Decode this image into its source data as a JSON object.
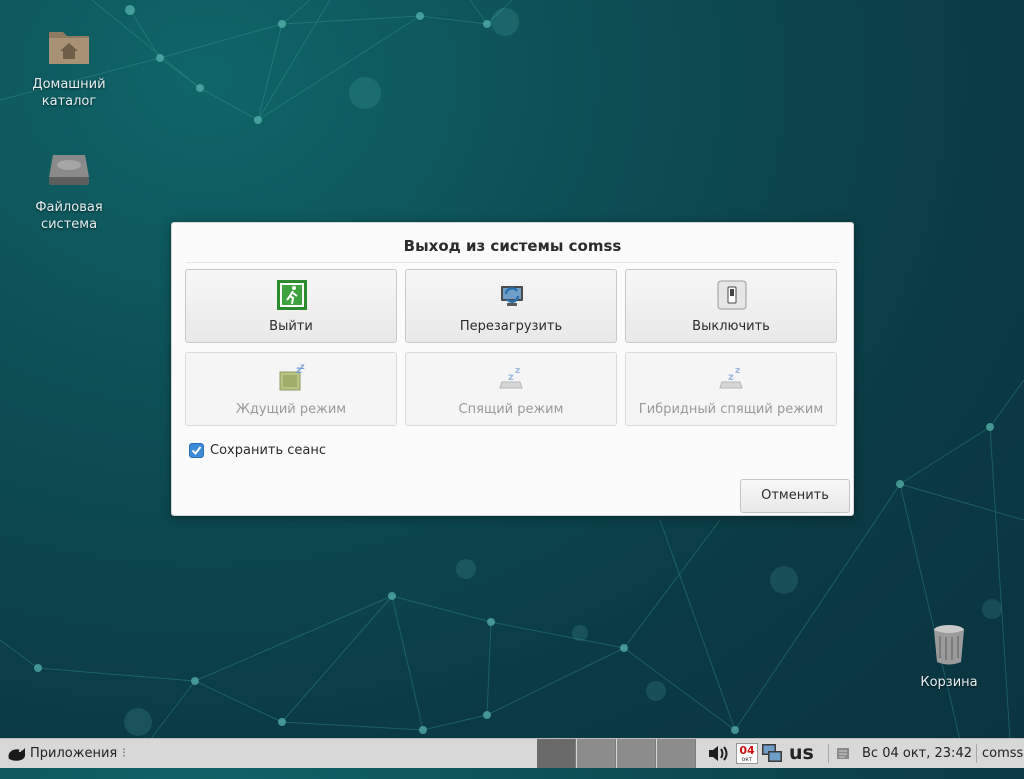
{
  "desktop": {
    "icons": [
      {
        "label": "Домашний каталог",
        "icon": "home-folder-icon"
      },
      {
        "label": "Файловая система",
        "icon": "drive-icon"
      },
      {
        "label": "Корзина",
        "icon": "trash-icon"
      }
    ]
  },
  "dialog": {
    "title": "Выход из системы comss",
    "actions": [
      {
        "label": "Выйти",
        "icon": "logout-icon",
        "enabled": true
      },
      {
        "label": "Перезагрузить",
        "icon": "restart-icon",
        "enabled": true
      },
      {
        "label": "Выключить",
        "icon": "shutdown-icon",
        "enabled": true
      },
      {
        "label": "Ждущий режим",
        "icon": "suspend-icon",
        "enabled": false
      },
      {
        "label": "Спящий режим",
        "icon": "hibernate-icon",
        "enabled": false
      },
      {
        "label": "Гибридный спящий режим",
        "icon": "hybrid-sleep-icon",
        "enabled": false
      }
    ],
    "save_session": {
      "label": "Сохранить сеанс",
      "checked": true
    },
    "cancel_label": "Отменить"
  },
  "panel": {
    "apps_label": "Приложения",
    "calendar": {
      "day": "04",
      "month": "окт"
    },
    "keyboard_layout": "us",
    "clock": "Вс 04 окт, 23:42",
    "user": "comss"
  },
  "colors": {
    "accent": "#3c8ad8",
    "desktop": "#0d4e55",
    "panel": "#d8d8d8"
  }
}
